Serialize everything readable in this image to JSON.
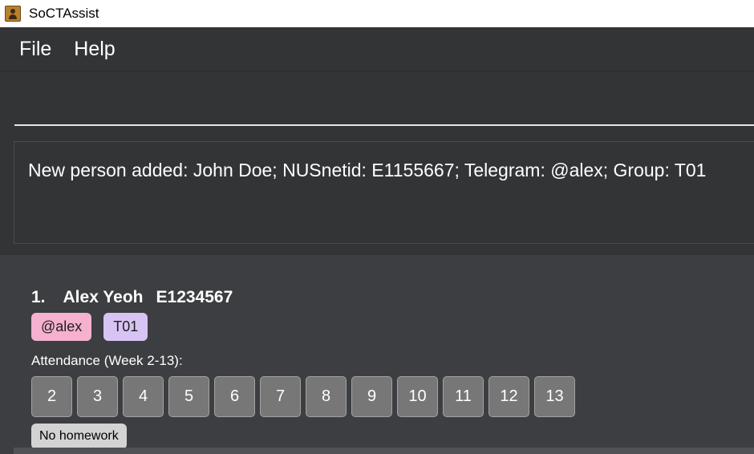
{
  "window": {
    "title": "SoCTAssist"
  },
  "menu": {
    "items": [
      "File",
      "Help"
    ]
  },
  "command": {
    "value": ""
  },
  "result": {
    "text": "New person added: John Doe; NUSnetid: E1155667; Telegram: @alex; Group: T01"
  },
  "persons": [
    {
      "index": "1.",
      "name": "Alex Yeoh",
      "netid": "E1234567",
      "telegram": "@alex",
      "group": "T01",
      "attendance_label": "Attendance (Week 2-13):",
      "weeks": [
        "2",
        "3",
        "4",
        "5",
        "6",
        "7",
        "8",
        "9",
        "10",
        "11",
        "12",
        "13"
      ],
      "homework": "No homework"
    }
  ],
  "colors": {
    "background": "#3c3e41",
    "menubar": "#333436",
    "telegram_tag": "#f5b1cf",
    "group_tag": "#d7c4f3",
    "week_box": "#777777",
    "homework_badge": "#d3d3d3"
  }
}
